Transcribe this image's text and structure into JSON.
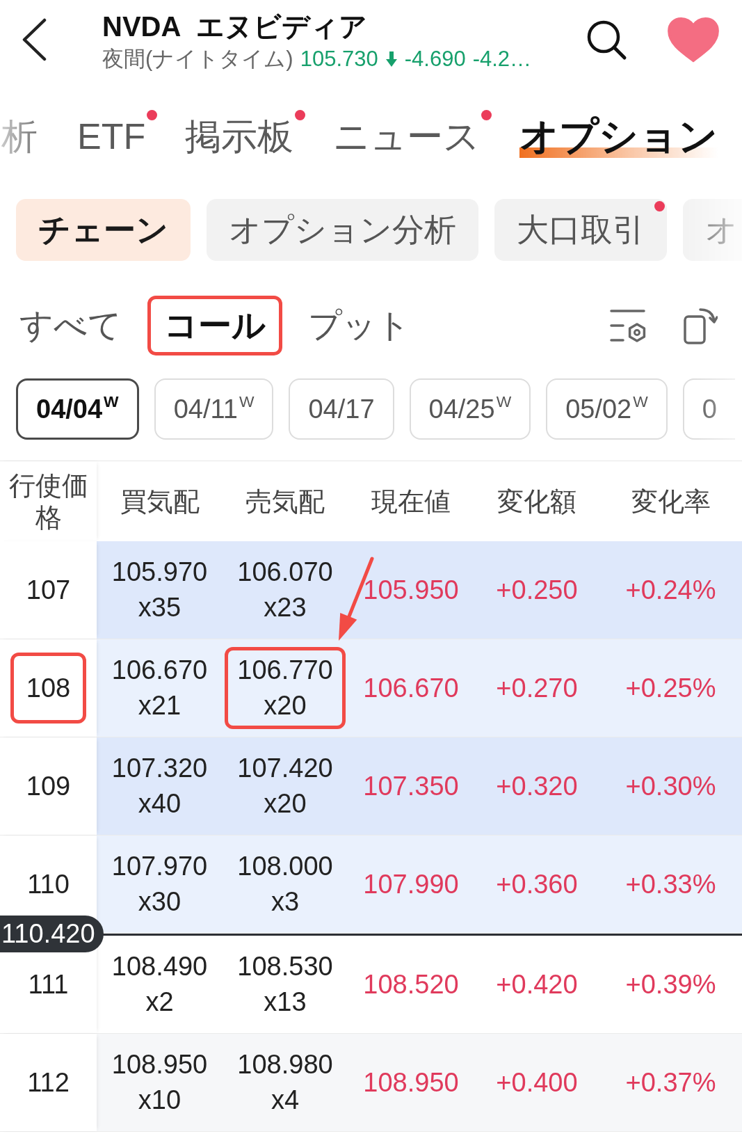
{
  "header": {
    "symbol": "NVDA",
    "name": "エヌビディア",
    "session": "夜間(ナイトタイム)",
    "price": "105.730",
    "down": true,
    "change": "-4.690",
    "change_pct": "-4.2…",
    "favorite": true
  },
  "tabs": [
    {
      "label": "析",
      "selected": false,
      "dot": false
    },
    {
      "label": "ETF",
      "selected": false,
      "dot": true
    },
    {
      "label": "掲示板",
      "selected": false,
      "dot": true
    },
    {
      "label": "ニュース",
      "selected": false,
      "dot": true
    },
    {
      "label": "オプション",
      "selected": true,
      "dot": false
    }
  ],
  "views": [
    {
      "label": "チェーン",
      "selected": true,
      "dot": false
    },
    {
      "label": "オプション分析",
      "selected": false,
      "dot": false
    },
    {
      "label": "大口取引",
      "selected": false,
      "dot": true
    },
    {
      "label": "オ",
      "selected": false,
      "dot": false
    }
  ],
  "filters": [
    {
      "label": "すべて",
      "selected": false,
      "marked": false
    },
    {
      "label": "コール",
      "selected": true,
      "marked": true
    },
    {
      "label": "プット",
      "selected": false,
      "marked": false
    }
  ],
  "expirations": [
    {
      "label": "04/04$^{W}$",
      "selected": true
    },
    {
      "label": "04/11$^{W}$",
      "selected": false
    },
    {
      "label": "04/17",
      "selected": false
    },
    {
      "label": "04/25$^{W}$",
      "selected": false
    },
    {
      "label": "05/02$^{W}$",
      "selected": false
    },
    {
      "label": "0",
      "selected": false
    }
  ],
  "table": {
    "columns": [
      "行使価格",
      "買気配",
      "売気配",
      "現在値",
      "変化額",
      "変化率"
    ],
    "rows": [
      {
        "kind": "option",
        "strike": "107",
        "in_the_money": true,
        "strike_marked": false,
        "bid": "105.970",
        "bid_size": "x35",
        "ask": "106.070",
        "ask_size": "x23",
        "ask_marked": false,
        "ask_arrow": false,
        "last": "105.950",
        "change": "+0.250",
        "change_pct": "+0.24%",
        "up": true
      },
      {
        "kind": "option",
        "strike": "108",
        "in_the_money": true,
        "strike_marked": true,
        "bid": "106.670",
        "bid_size": "x21",
        "ask": "106.770",
        "ask_size": "x20",
        "ask_marked": true,
        "ask_arrow": true,
        "last": "106.670",
        "change": "+0.270",
        "change_pct": "+0.25%",
        "up": true
      },
      {
        "kind": "option",
        "strike": "109",
        "in_the_money": true,
        "strike_marked": false,
        "bid": "107.320",
        "bid_size": "x40",
        "ask": "107.420",
        "ask_size": "x20",
        "ask_marked": false,
        "ask_arrow": false,
        "last": "107.350",
        "change": "+0.320",
        "change_pct": "+0.30%",
        "up": true
      },
      {
        "kind": "option",
        "strike": "110",
        "in_the_money": true,
        "strike_marked": false,
        "bid": "107.970",
        "bid_size": "x30",
        "ask": "108.000",
        "ask_size": "x3",
        "ask_marked": false,
        "ask_arrow": false,
        "last": "107.990",
        "change": "+0.360",
        "change_pct": "+0.33%",
        "up": true
      },
      {
        "kind": "price_line",
        "label": "110.420"
      },
      {
        "kind": "option",
        "strike": "111",
        "in_the_money": false,
        "strike_marked": false,
        "bid": "108.490",
        "bid_size": "x2",
        "ask": "108.530",
        "ask_size": "x13",
        "ask_marked": false,
        "ask_arrow": false,
        "last": "108.520",
        "change": "+0.420",
        "change_pct": "+0.39%",
        "up": true
      },
      {
        "kind": "option",
        "strike": "112",
        "in_the_money": false,
        "strike_marked": false,
        "bid": "108.950",
        "bid_size": "x10",
        "ask": "108.980",
        "ask_size": "x4",
        "ask_marked": false,
        "ask_arrow": false,
        "last": "108.950",
        "change": "+0.400",
        "change_pct": "+0.37%",
        "up": true
      }
    ]
  }
}
